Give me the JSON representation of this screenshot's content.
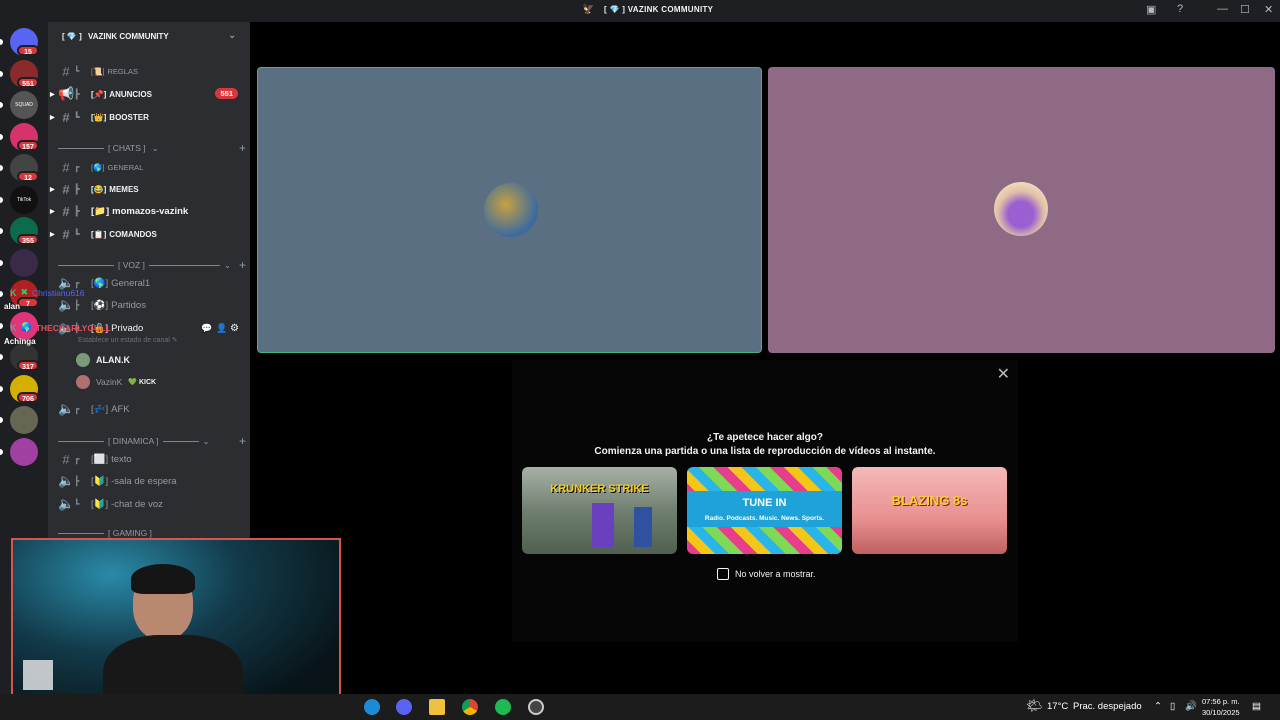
{
  "window": {
    "title": "VAZINK COMMUNITY",
    "title_prefix": "[ 💎 ]"
  },
  "servers": [
    {
      "badge": "15",
      "color": "#5865f2"
    },
    {
      "badge": "551",
      "color": "#8b2a2a"
    },
    {
      "badge": "",
      "color": "#555",
      "text": "SQUAD"
    },
    {
      "badge": "157",
      "color": "#d6336c"
    },
    {
      "badge": "12",
      "color": "#444"
    },
    {
      "badge": "",
      "color": "#111",
      "text": "TikTok"
    },
    {
      "badge": "355",
      "color": "#0d6b4c"
    },
    {
      "badge": "",
      "color": "#3a2a4a"
    },
    {
      "badge": "7",
      "color": "#b02020"
    },
    {
      "badge": "",
      "color": "#e0357a"
    },
    {
      "badge": "317",
      "color": "#333"
    },
    {
      "badge": "706",
      "color": "#d6b000"
    },
    {
      "badge": "",
      "color": "#665"
    },
    {
      "badge": "",
      "color": "#a040a0"
    }
  ],
  "server_header": {
    "name": "VAZINK COMMUNITY",
    "prefix": "[ 💎 ]"
  },
  "channels": {
    "reglas": "REGLAS",
    "anuncios": "ANUNCIOS",
    "anuncios_badge": "551",
    "booster": "BOOSTER",
    "cat_chats": "[ CHATS ]",
    "general": "GENERAL",
    "memes": "MEMES",
    "momazos": "momazos-vazink",
    "comandos": "COMANDOS",
    "cat_voz": "[ VOZ ]",
    "general1": "General1",
    "partidos": "Partidos",
    "privado": "Privado",
    "status_hint": "Establece un estado de canal",
    "afk": "AFK",
    "cat_dinamica": "[ DINAMICA ]",
    "texto": "texto",
    "sala_espera": "-sala de espera",
    "chat_voz": "-chat de voz",
    "cat_gaming": "[ GAMING ]"
  },
  "voice_users": [
    {
      "name": "ALAN.K",
      "tag": ""
    },
    {
      "name": "VazinK",
      "tag": "KICK"
    }
  ],
  "overlay": {
    "user1": "Christianu616",
    "user2": "THECHARLYGULL",
    "alan": "alan",
    "achinga": "Achinga"
  },
  "tiles": {
    "left_color": "#5b6f82",
    "right_color": "#8e6a85",
    "speaking_border": "#43b581"
  },
  "activity": {
    "question": "¿Te apetece hacer algo?",
    "subtitle": "Comienza una partida o una lista de reproducción de vídeos al instante.",
    "cards": [
      {
        "label": "KRUNKER STRIKE",
        "color": "#7a8a7a"
      },
      {
        "label": "TUNE IN",
        "sub": "Radio. Podcasts. Music. News. Sports.",
        "color": "#2a9bd8"
      },
      {
        "label": "BLAZING 8s",
        "color": "#e7a8a8"
      }
    ],
    "dont_show": "No volver a mostrar.",
    "close_icon": "close-icon"
  },
  "taskbar": {
    "weather_temp": "17°C",
    "weather_desc": "Prac. despejado",
    "time": "07:56 p. m.",
    "date": "30/10/2025"
  }
}
